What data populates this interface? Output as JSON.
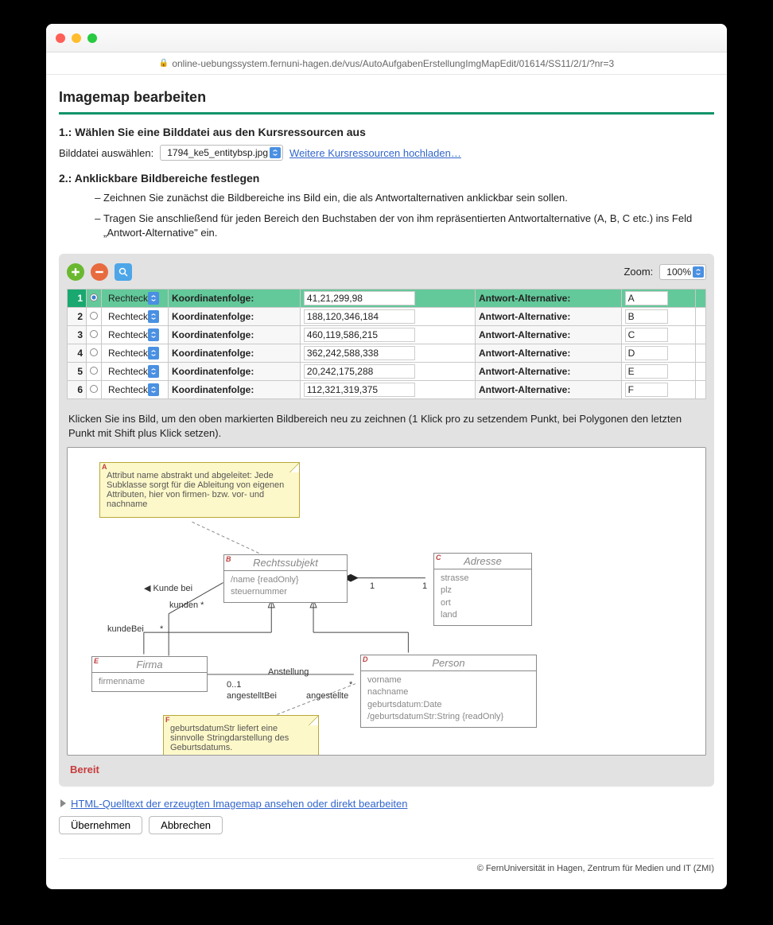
{
  "url": "online-uebungssystem.fernuni-hagen.de/vus/AutoAufgabenErstellungImgMapEdit/01614/SS11/2/1/?nr=3",
  "page_title": "Imagemap bearbeiten",
  "step1": {
    "heading": "1.: Wählen Sie eine Bilddatei aus den Kursressourcen aus",
    "label": "Bilddatei auswählen:",
    "file": "1794_ke5_entitybsp.jpg",
    "upload_link": "Weitere Kursressourcen hochladen…"
  },
  "step2": {
    "heading": "2.: Anklickbare Bildbereiche festlegen",
    "bullets": [
      "Zeichnen Sie zunächst die Bildbereiche ins Bild ein, die als Antwortalternativen anklickbar sein sollen.",
      "Tragen Sie anschließend für jeden Bereich den Buchstaben der von ihm repräsentierten Antwortalternative (A, B, C etc.) ins Feld „Antwort-Alternative\" ein."
    ]
  },
  "zoom_label": "Zoom:",
  "zoom_value": "100%",
  "col_shape": "Rechteck",
  "col_coord_label": "Koordinatenfolge:",
  "col_alt_label": "Antwort-Alternative:",
  "rows": [
    {
      "n": "1",
      "shape": "Rechteck",
      "coords": "41,21,299,98",
      "alt": "A",
      "sel": true
    },
    {
      "n": "2",
      "shape": "Rechteck",
      "coords": "188,120,346,184",
      "alt": "B",
      "sel": false
    },
    {
      "n": "3",
      "shape": "Rechteck",
      "coords": "460,119,586,215",
      "alt": "C",
      "sel": false
    },
    {
      "n": "4",
      "shape": "Rechteck",
      "coords": "362,242,588,338",
      "alt": "D",
      "sel": false
    },
    {
      "n": "5",
      "shape": "Rechteck",
      "coords": "20,242,175,288",
      "alt": "E",
      "sel": false
    },
    {
      "n": "6",
      "shape": "Rechteck",
      "coords": "112,321,319,375",
      "alt": "F",
      "sel": false
    }
  ],
  "draw_hint": "Klicken Sie ins Bild, um den oben markierten Bildbereich neu zu zeichnen (1 Klick pro zu setzendem Punkt, bei Polygonen den letzten Punkt mit Shift plus Klick setzen).",
  "diagram": {
    "noteA": {
      "tag": "A",
      "text": "Attribut name abstrakt und abgeleitet: Jede Subklasse sorgt für die Ableitung von eigenen Attributen, hier von firmen- bzw. vor- und nachname"
    },
    "noteF": {
      "tag": "F",
      "text": "geburtsdatumStr liefert eine sinnvolle Stringdarstellung des Geburtsdatums."
    },
    "boxB": {
      "tag": "B",
      "title": "Rechtssubjekt",
      "lines": [
        "/name {readOnly}",
        "steuernummer"
      ]
    },
    "boxC": {
      "tag": "C",
      "title": "Adresse",
      "lines": [
        "strasse",
        "plz",
        "ort",
        "land"
      ]
    },
    "boxD": {
      "tag": "D",
      "title": "Person",
      "lines": [
        "vorname",
        "nachname",
        "geburtsdatum:Date",
        "/geburtsdatumStr:String {readOnly}"
      ]
    },
    "boxE": {
      "tag": "E",
      "title": "Firma",
      "lines": [
        "firmenname"
      ]
    },
    "labels": {
      "kundebei": "◀ Kunde bei",
      "kunden": "kunden  *",
      "kundeBei": "kundeBei",
      "star": "*",
      "anstellung": "Anstellung",
      "angBei": "angestelltBei",
      "ang": "angestellte",
      "m01": "0..1",
      "ms": "*",
      "one1": "1",
      "one2": "1"
    }
  },
  "status": "Bereit",
  "html_src_link": "HTML-Quelltext der erzeugten Imagemap ansehen oder direkt bearbeiten",
  "btn_ok": "Übernehmen",
  "btn_cancel": "Abbrechen",
  "footer": "© FernUniversität in Hagen, Zentrum für Medien und IT (ZMI)"
}
